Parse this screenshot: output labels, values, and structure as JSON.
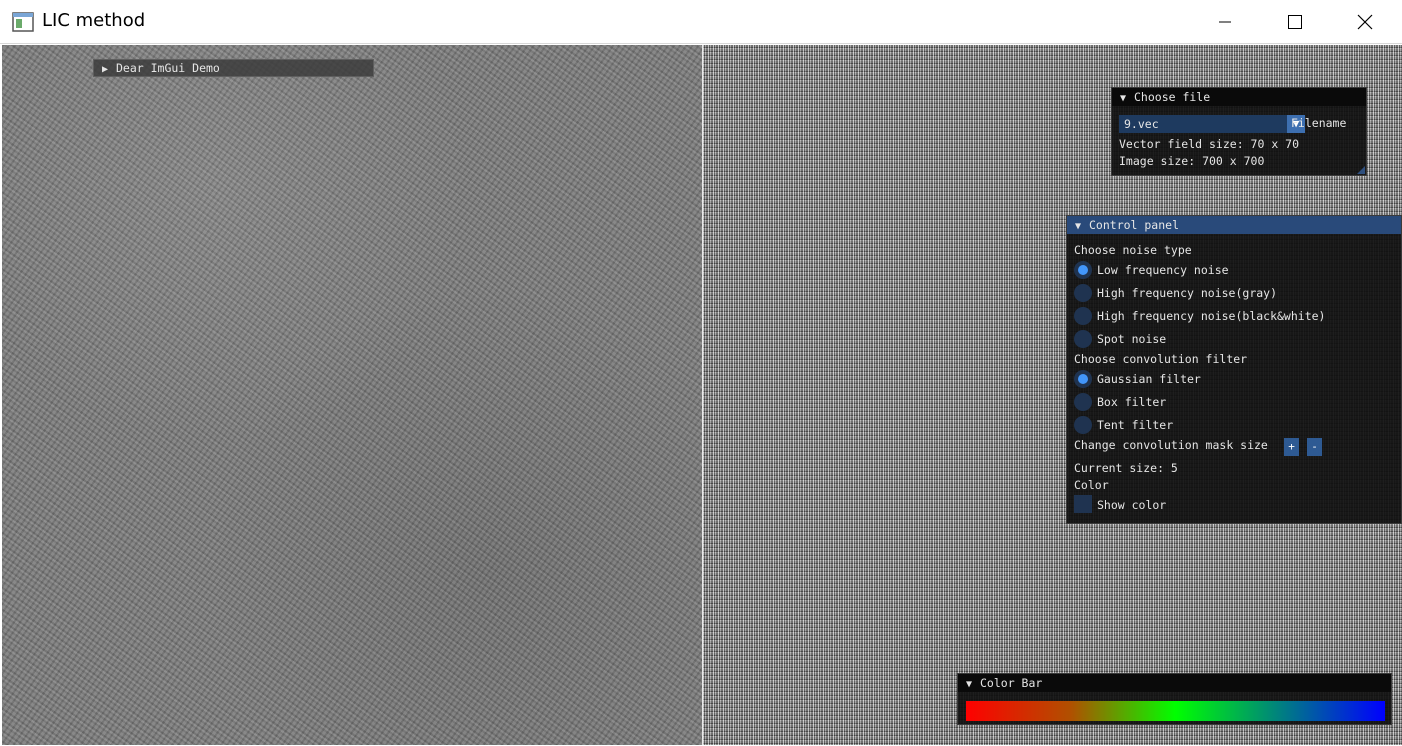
{
  "window": {
    "title": "LIC method",
    "icon": "app-window-icon",
    "controls": [
      "minimize-icon",
      "maximize-icon",
      "close-icon"
    ]
  },
  "demo_window": {
    "title": "Dear ImGui Demo",
    "collapsed": true
  },
  "choose_file": {
    "title": "Choose file",
    "selected_file": "9.vec",
    "combo_label": "Filename",
    "vector_field_size": "Vector field size: 70 x 70",
    "image_size": "Image size: 700 x 700"
  },
  "control_panel": {
    "title": "Control panel",
    "noise_heading": "Choose noise type",
    "noise_options": [
      {
        "label": "Low frequency noise",
        "selected": true
      },
      {
        "label": "High frequency noise(gray)",
        "selected": false
      },
      {
        "label": "High frequency noise(black&white)",
        "selected": false
      },
      {
        "label": "Spot noise",
        "selected": false
      }
    ],
    "filter_heading": "Choose convolution filter",
    "filter_options": [
      {
        "label": "Gaussian filter",
        "selected": true
      },
      {
        "label": "Box filter",
        "selected": false
      },
      {
        "label": "Tent filter",
        "selected": false
      }
    ],
    "mask_label": "Change convolution mask size",
    "plus_label": "+",
    "minus_label": "-",
    "current_size": "Current size: 5",
    "color_heading": "Color",
    "show_color_label": "Show color",
    "show_color_checked": false
  },
  "color_bar": {
    "title": "Color Bar",
    "stops": [
      "#ff0000",
      "#b05000",
      "#00ff00",
      "#008080",
      "#0000ff"
    ]
  },
  "colors": {
    "accent": "#4296fa",
    "title_active": "#294a7a",
    "panel_bg": "#0f0f0f"
  }
}
